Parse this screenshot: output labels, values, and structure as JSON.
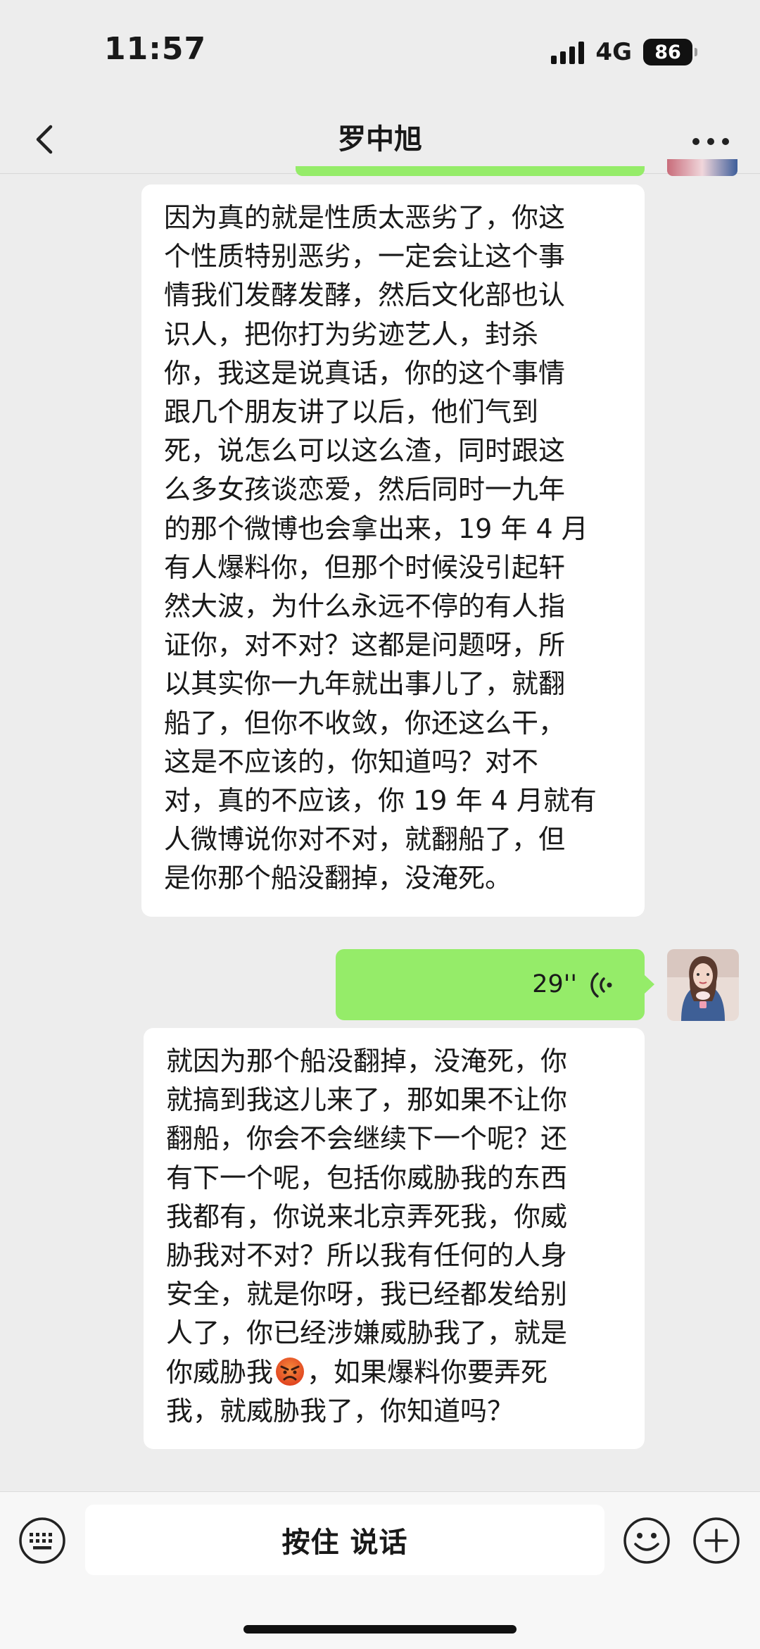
{
  "status_bar": {
    "time": "11:57",
    "network": "4G",
    "battery": "86"
  },
  "header": {
    "title": "罗中旭"
  },
  "messages": [
    {
      "type": "text",
      "text": "因为真的就是性质太恶劣了，你这\n个性质特别恶劣，一定会让这个事\n情我们发酵发酵，然后文化部也认\n识人，把你打为劣迹艺人，封杀\n你，我这是说真话，你的这个事情\n跟几个朋友讲了以后，他们气到\n死，说怎么可以这么渣，同时跟这\n么多女孩谈恋爱，然后同时一九年\n的那个微博也会拿出来，19 年 4 月\n有人爆料你，但那个时候没引起轩\n然大波，为什么永远不停的有人指\n证你，对不对？这都是问题呀，所\n以其实你一九年就出事儿了，就翻\n船了，但你不收敛，你还这么干，\n这是不应该的，你知道吗？对不\n对，真的不应该，你 19 年 4 月就有\n人微博说你对不对，就翻船了，但\n是你那个船没翻掉，没淹死。"
    },
    {
      "type": "voice",
      "duration": "29''"
    },
    {
      "type": "text",
      "text_before_emoji": "就因为那个船没翻掉，没淹死，你\n就搞到我这儿来了，那如果不让你\n翻船，你会不会继续下一个呢？还\n有下一个呢，包括你威胁我的东西\n我都有，你说来北京弄死我，你威\n胁我对不对？所以我有任何的人身\n安全，就是你呀，我已经都发给别\n人了，你已经涉嫌威胁我了，就是\n你威胁我",
      "emoji": "angry-face-icon",
      "text_after_emoji": "，如果爆料你要弄死\n我，就威胁我了，你知道吗？"
    }
  ],
  "input_bar": {
    "hold_to_talk": "按住 说话"
  },
  "colors": {
    "background": "#ededed",
    "sent_bubble": "#95ec69",
    "received_bubble": "#ffffff"
  }
}
